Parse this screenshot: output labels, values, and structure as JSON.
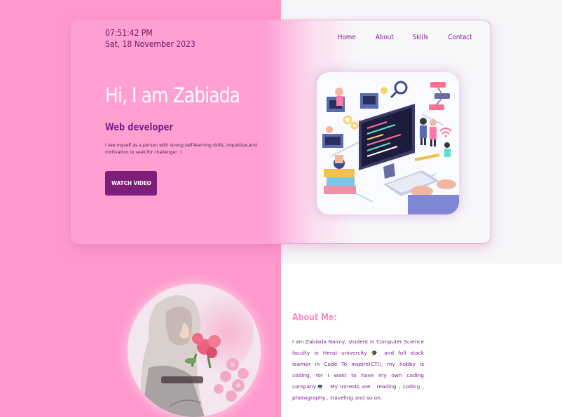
{
  "clock": {
    "time": "07:51:42 PM",
    "date": "Sat, 18 November 2023"
  },
  "nav": {
    "items": [
      "Home",
      "About",
      "Skills",
      "Contact"
    ]
  },
  "hero": {
    "greeting": "Hi, I am Zabiada",
    "role": "Web developer",
    "bio": "I see myself as a person with strong self-learning skills, inquistive,and motivation to seek for challenger :)",
    "button_label": "WATCH VIDEO"
  },
  "about": {
    "title": "About Me:",
    "text": "I am Zabiada Naimy, student in Computer Science faculty in Herat univercity 🎓 and full stack learner in Code To Inspire(CTI), my hobby is coding, for I want to have my own coding company💻 . My Intrests are : reading , coding , photography , traveling and so on."
  },
  "colors": {
    "pink_bg": "#ff99cc",
    "accent_purple": "#7d1f7a",
    "about_title": "#f48fc8",
    "page_bg_right": "#f6f6f8"
  },
  "icons": [
    "developer-illustration",
    "profile-avatar"
  ]
}
